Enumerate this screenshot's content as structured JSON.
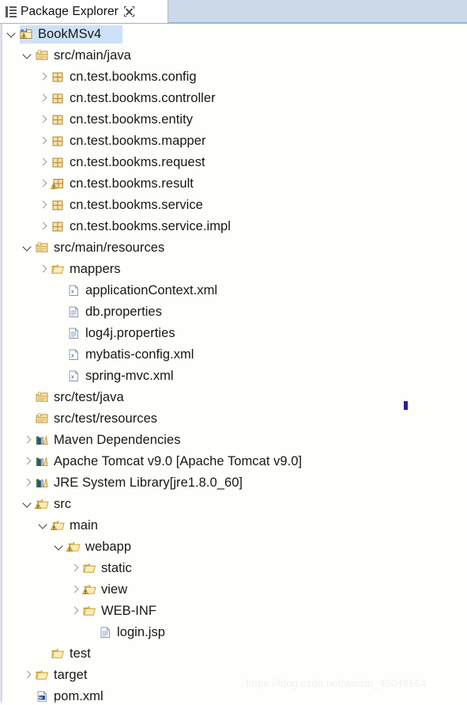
{
  "window": {
    "tab": {
      "label": "Package Explorer",
      "icon": "package-explorer-view-icon",
      "close_icon": "close-icon"
    }
  },
  "colors": {
    "selection_bg": "#cde2f7",
    "tabbar_bg": "#ccd9e9",
    "tree_bg": "#fefffb",
    "folder": "#f2c14a",
    "package": "#d9a441",
    "dim_text": "#7d7d7d",
    "text": "#171717",
    "artifact": "#2b1f8f"
  },
  "watermark": "https://blog.csdn.net/weixin_45048564",
  "tree": {
    "rows": [
      {
        "label": "BookMSv4",
        "icon": "maven-java-project-icon",
        "indent": 0,
        "twisty": "open",
        "selected": true,
        "sel_width": 130
      },
      {
        "label": "src/main/java",
        "icon": "source-folder-icon",
        "indent": 1,
        "twisty": "open",
        "selected": false
      },
      {
        "label": "cn.test.bookms.config",
        "icon": "package-icon",
        "indent": 2,
        "twisty": "closed",
        "selected": false
      },
      {
        "label": "cn.test.bookms.controller",
        "icon": "package-icon",
        "indent": 2,
        "twisty": "closed",
        "selected": false
      },
      {
        "label": "cn.test.bookms.entity",
        "icon": "package-icon",
        "indent": 2,
        "twisty": "closed",
        "selected": false
      },
      {
        "label": "cn.test.bookms.mapper",
        "icon": "package-icon",
        "indent": 2,
        "twisty": "closed",
        "selected": false
      },
      {
        "label": "cn.test.bookms.request",
        "icon": "package-icon",
        "indent": 2,
        "twisty": "closed",
        "selected": false
      },
      {
        "label": "cn.test.bookms.result",
        "icon": "package-warning-icon",
        "indent": 2,
        "twisty": "closed",
        "selected": false
      },
      {
        "label": "cn.test.bookms.service",
        "icon": "package-icon",
        "indent": 2,
        "twisty": "closed",
        "selected": false
      },
      {
        "label": "cn.test.bookms.service.impl",
        "icon": "package-icon",
        "indent": 2,
        "twisty": "closed",
        "selected": false
      },
      {
        "label": "src/main/resources",
        "icon": "source-folder-icon",
        "indent": 1,
        "twisty": "open",
        "selected": false
      },
      {
        "label": "mappers",
        "icon": "folder-icon",
        "indent": 2,
        "twisty": "closed",
        "selected": false
      },
      {
        "label": "applicationContext.xml",
        "icon": "xml-file-icon",
        "indent": 3,
        "twisty": "none",
        "selected": false
      },
      {
        "label": "db.properties",
        "icon": "properties-file-icon",
        "indent": 3,
        "twisty": "none",
        "selected": false
      },
      {
        "label": "log4j.properties",
        "icon": "properties-file-icon",
        "indent": 3,
        "twisty": "none",
        "selected": false
      },
      {
        "label": "mybatis-config.xml",
        "icon": "xml-file-icon",
        "indent": 3,
        "twisty": "none",
        "selected": false
      },
      {
        "label": "spring-mvc.xml",
        "icon": "xml-file-icon",
        "indent": 3,
        "twisty": "none",
        "selected": false
      },
      {
        "label": "src/test/java",
        "icon": "source-folder-icon",
        "indent": 1,
        "twisty": "none",
        "selected": false
      },
      {
        "label": "src/test/resources",
        "icon": "source-folder-icon",
        "indent": 1,
        "twisty": "none",
        "selected": false
      },
      {
        "label": "Maven Dependencies",
        "icon": "library-icon",
        "indent": 1,
        "twisty": "closed",
        "selected": false
      },
      {
        "label": "Apache Tomcat v9.0 [Apache Tomcat v9.0]",
        "icon": "library-icon",
        "indent": 1,
        "twisty": "closed",
        "selected": false
      },
      {
        "label": "JRE System Library ",
        "label_dim": "[jre1.8.0_60]",
        "icon": "library-icon",
        "indent": 1,
        "twisty": "closed",
        "selected": false
      },
      {
        "label": "src",
        "icon": "folder-warning-icon",
        "indent": 1,
        "twisty": "open",
        "selected": false
      },
      {
        "label": "main",
        "icon": "folder-warning-icon",
        "indent": 2,
        "twisty": "open",
        "selected": false
      },
      {
        "label": "webapp",
        "icon": "folder-warning-icon",
        "indent": 3,
        "twisty": "open",
        "selected": false
      },
      {
        "label": "static",
        "icon": "folder-icon",
        "indent": 4,
        "twisty": "closed",
        "selected": false
      },
      {
        "label": "view",
        "icon": "folder-warning-icon",
        "indent": 4,
        "twisty": "closed",
        "selected": false
      },
      {
        "label": "WEB-INF",
        "icon": "folder-icon",
        "indent": 4,
        "twisty": "closed",
        "selected": false
      },
      {
        "label": "login.jsp",
        "icon": "jsp-file-icon",
        "indent": 5,
        "twisty": "none",
        "selected": false
      },
      {
        "label": "test",
        "icon": "folder-icon",
        "indent": 2,
        "twisty": "none",
        "selected": false
      },
      {
        "label": "target",
        "icon": "folder-icon",
        "indent": 1,
        "twisty": "closed",
        "selected": false
      },
      {
        "label": "pom.xml",
        "icon": "maven-pom-icon",
        "indent": 1,
        "twisty": "none",
        "selected": false
      }
    ]
  }
}
